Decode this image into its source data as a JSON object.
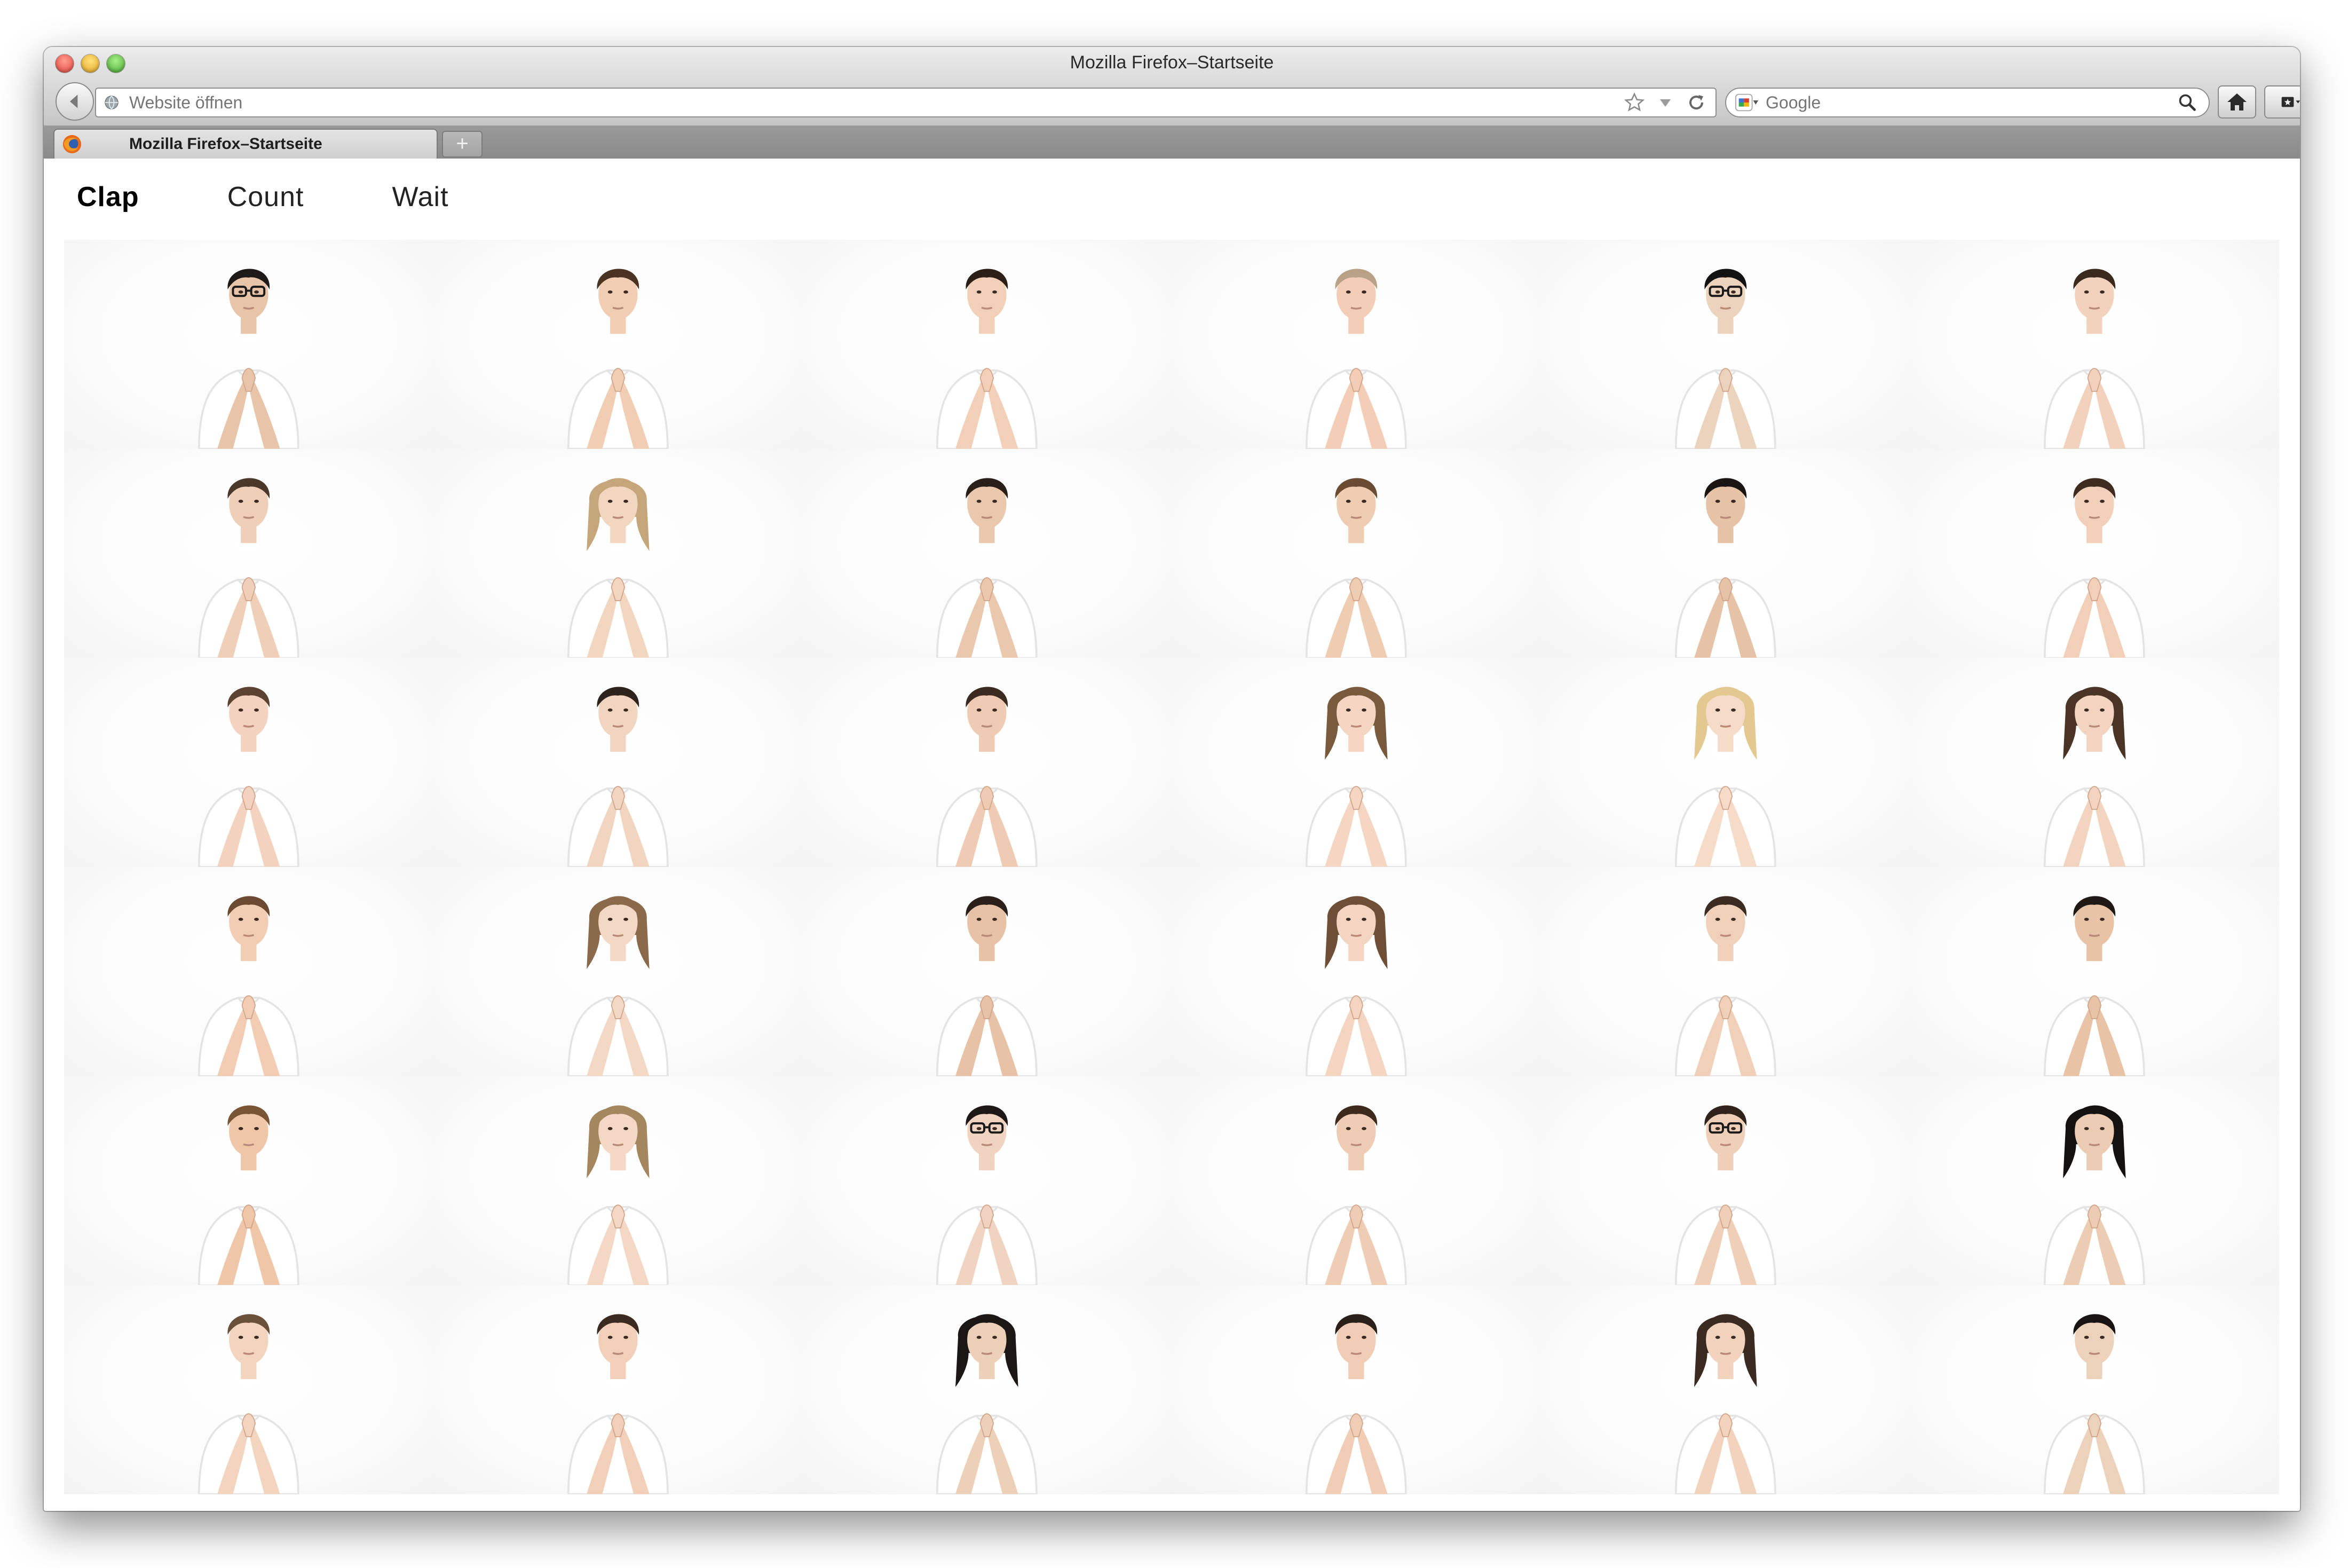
{
  "window": {
    "title": "Mozilla Firefox–Startseite"
  },
  "toolbar": {
    "url_placeholder": "Website öffnen",
    "search_engine": "Google",
    "search_placeholder": "Google"
  },
  "tab": {
    "title": "Mozilla Firefox–Startseite",
    "new_tab_label": "+"
  },
  "page": {
    "nav": [
      {
        "label": "Clap",
        "active": true
      },
      {
        "label": "Count",
        "active": false
      },
      {
        "label": "Wait",
        "active": false
      }
    ],
    "grid": {
      "rows": 6,
      "columns": 6,
      "people": [
        {
          "hair": "#1d1a18",
          "skin": "#e8c4a8",
          "long": false,
          "glasses": true
        },
        {
          "hair": "#4a3322",
          "skin": "#f0cdb3",
          "long": false,
          "glasses": false
        },
        {
          "hair": "#2b1f18",
          "skin": "#f2d0b8",
          "long": false,
          "glasses": false
        },
        {
          "hair": "#b9a186",
          "skin": "#f3cdb6",
          "long": false,
          "glasses": false
        },
        {
          "hair": "#121212",
          "skin": "#ecd3bd",
          "long": false,
          "glasses": true
        },
        {
          "hair": "#3a2a1e",
          "skin": "#f2d2bd",
          "long": false,
          "glasses": false
        },
        {
          "hair": "#4b3829",
          "skin": "#f0cfb8",
          "long": false,
          "glasses": false
        },
        {
          "hair": "#c4a67a",
          "skin": "#f2d6c0",
          "long": true,
          "glasses": false
        },
        {
          "hair": "#2a1e18",
          "skin": "#eac8ae",
          "long": false,
          "glasses": false
        },
        {
          "hair": "#6a4c33",
          "skin": "#efcdb2",
          "long": false,
          "glasses": false
        },
        {
          "hair": "#1a1512",
          "skin": "#e6c2a6",
          "long": false,
          "glasses": false
        },
        {
          "hair": "#3f2b1f",
          "skin": "#f1cfb8",
          "long": false,
          "glasses": false
        },
        {
          "hair": "#5c4331",
          "skin": "#f3d3bf",
          "long": false,
          "glasses": false
        },
        {
          "hair": "#2e231c",
          "skin": "#f2d5c1",
          "long": false,
          "glasses": false
        },
        {
          "hair": "#3a2a1f",
          "skin": "#eecbb2",
          "long": false,
          "glasses": false
        },
        {
          "hair": "#7a5a3c",
          "skin": "#f4d6c3",
          "long": true,
          "glasses": false
        },
        {
          "hair": "#e3c88f",
          "skin": "#f5dbc8",
          "long": true,
          "glasses": false
        },
        {
          "hair": "#4a3426",
          "skin": "#f3d4c1",
          "long": true,
          "glasses": false
        },
        {
          "hair": "#6b4a31",
          "skin": "#f2cdb4",
          "long": false,
          "glasses": false
        },
        {
          "hair": "#8a6a4b",
          "skin": "#f4d8c6",
          "long": true,
          "glasses": false
        },
        {
          "hair": "#2b2019",
          "skin": "#e7c2a6",
          "long": false,
          "glasses": false
        },
        {
          "hair": "#6e4f36",
          "skin": "#f3d5c1",
          "long": true,
          "glasses": false
        },
        {
          "hair": "#3b2b21",
          "skin": "#f1d0b9",
          "long": false,
          "glasses": false
        },
        {
          "hair": "#1f1814",
          "skin": "#e8c3a5",
          "long": false,
          "glasses": false
        },
        {
          "hair": "#7a5535",
          "skin": "#efc6a8",
          "long": false,
          "glasses": false
        },
        {
          "hair": "#a4865f",
          "skin": "#f4d8c5",
          "long": true,
          "glasses": false
        },
        {
          "hair": "#1d1715",
          "skin": "#f0d3c0",
          "long": false,
          "glasses": true
        },
        {
          "hair": "#3d2a1d",
          "skin": "#efcdb4",
          "long": false,
          "glasses": false
        },
        {
          "hair": "#2f231b",
          "skin": "#f0cfb9",
          "long": false,
          "glasses": true
        },
        {
          "hair": "#141211",
          "skin": "#eccdb3",
          "long": true,
          "glasses": false
        },
        {
          "hair": "#6a5039",
          "skin": "#f3d4bf",
          "long": false,
          "glasses": false
        },
        {
          "hair": "#3a2a1f",
          "skin": "#f1cfb8",
          "long": false,
          "glasses": false
        },
        {
          "hair": "#1b1714",
          "skin": "#ecd0b8",
          "long": true,
          "glasses": false
        },
        {
          "hair": "#2a1f19",
          "skin": "#f0cdb4",
          "long": false,
          "glasses": false
        },
        {
          "hair": "#3a2a20",
          "skin": "#f2d3be",
          "long": true,
          "glasses": false
        },
        {
          "hair": "#171413",
          "skin": "#ecd1bb",
          "long": false,
          "glasses": false
        }
      ]
    }
  },
  "colors": {
    "shirt": "#ffffff",
    "shirt_shadow": "#e4e4e4"
  }
}
